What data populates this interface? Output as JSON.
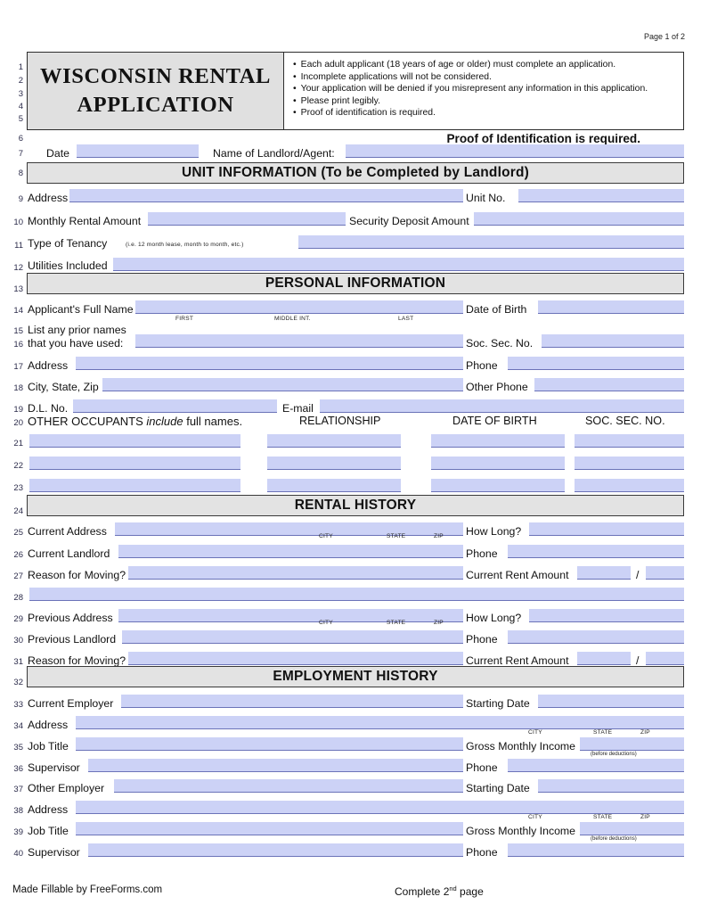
{
  "page": {
    "page_indicator": "Page 1 of 2",
    "title_line1": "WISCONSIN RENTAL",
    "title_line2": "APPLICATION",
    "instructions": [
      "Each adult applicant (18 years of age or older) must complete an application.",
      "Incomplete applications will not be considered.",
      "Your application will be denied if you misrepresent any information in this application.",
      "Please print legibly.",
      "Proof of identification is required."
    ],
    "proof_notice": "Proof of Identification is required."
  },
  "line_numbers": [
    "1",
    "2",
    "3",
    "4",
    "5",
    "6",
    "7",
    "8",
    "9",
    "10",
    "11",
    "12",
    "13",
    "14",
    "15",
    "16",
    "17",
    "18",
    "19",
    "20",
    "21",
    "22",
    "23",
    "24",
    "25",
    "26",
    "27",
    "28",
    "29",
    "30",
    "31",
    "32",
    "33",
    "34",
    "35",
    "36",
    "37",
    "38",
    "39",
    "40"
  ],
  "sections": {
    "unit_information": {
      "title_main": "UNIT INFORMATION",
      "title_paren_open": "(T",
      "title_sub": "o be Completed by Landlord",
      "title_full": "UNIT INFORMATION  (To be Completed by Landlord)"
    },
    "personal_information": {
      "title": "PERSONAL INFORMATION"
    },
    "rental_history": {
      "title": "RENTAL HISTORY"
    },
    "employment_history": {
      "title": "EMPLOYMENT HISTORY"
    }
  },
  "date_row": {
    "date_label": "Date",
    "date_value": "",
    "landlord_label": "Name of Landlord/Agent:",
    "landlord_value": ""
  },
  "unit": {
    "address_label": "Address",
    "address_value": "",
    "unit_no_label": "Unit No.",
    "unit_no_value": "",
    "monthly_rental_label": "Monthly Rental Amount",
    "monthly_rental_value": "",
    "security_deposit_label": "Security Deposit Amount",
    "security_deposit_value": "",
    "tenancy_label": "Type of Tenancy",
    "tenancy_hint": "(i.e. 12 month lease, month to month, etc.)",
    "tenancy_value": "",
    "utilities_label": "Utilities Included",
    "utilities_value": ""
  },
  "personal": {
    "full_name_label": "Applicant's Full Name",
    "full_name_value": "",
    "name_sub_first": "FIRST",
    "name_sub_middle": "MIDDLE INT.",
    "name_sub_last": "LAST",
    "dob_label": "Date of Birth",
    "dob_value": "",
    "prior_names_label_line1": "List any prior names",
    "prior_names_label_line2": "that you have used:",
    "prior_names_value": "",
    "ssn_label": "Soc. Sec. No.",
    "ssn_value": "",
    "address_label": "Address",
    "address_value": "",
    "phone_label": "Phone",
    "phone_value": "",
    "city_state_zip_label": "City, State, Zip",
    "city_state_zip_value": "",
    "other_phone_label": "Other Phone",
    "other_phone_value": "",
    "dl_label": "D.L. No.",
    "dl_value": "",
    "email_label": "E-mail",
    "email_value": ""
  },
  "occupants": {
    "heading_a": "OTHER OCCUPANTS ",
    "heading_italic": "include",
    "heading_b": " full names.",
    "col_relationship": "RELATIONSHIP",
    "col_dob": "DATE OF BIRTH",
    "col_ssn": "SOC. SEC. NO.",
    "rows": [
      {
        "name": "",
        "relationship": "",
        "dob": "",
        "ssn": ""
      },
      {
        "name": "",
        "relationship": "",
        "dob": "",
        "ssn": ""
      },
      {
        "name": "",
        "relationship": "",
        "dob": "",
        "ssn": ""
      }
    ]
  },
  "rental_history": {
    "current_address_label": "Current Address",
    "current_address_value": "",
    "how_long_label": "How Long?",
    "how_long_value": "",
    "sub_city": "CITY",
    "sub_state": "STATE",
    "sub_zip": "ZIP",
    "current_landlord_label": "Current Landlord",
    "current_landlord_value": "",
    "phone_label": "Phone",
    "phone_value": "",
    "reason_moving_label": "Reason for Moving?",
    "reason_moving_value": "",
    "current_rent_label": "Current Rent Amount",
    "current_rent_value": "",
    "current_rent_sep": "/",
    "current_rent_per_value": "",
    "continuation_value": "",
    "previous_address_label": "Previous Address",
    "previous_address_value": "",
    "prev_how_long_label": "How Long?",
    "prev_how_long_value": "",
    "previous_landlord_label": "Previous Landlord",
    "previous_landlord_value": "",
    "prev_phone_label": "Phone",
    "prev_phone_value": "",
    "prev_reason_moving_label": "Reason for Moving?",
    "prev_reason_moving_value": "",
    "prev_current_rent_label": "Current Rent Amount",
    "prev_current_rent_value": "",
    "prev_current_rent_sep": "/",
    "prev_current_rent_per_value": ""
  },
  "employment": {
    "current_employer_label": "Current Employer",
    "current_employer_value": "",
    "starting_date_label": "Starting Date",
    "starting_date_value": "",
    "address_label": "Address",
    "address_value": "",
    "sub_city": "CITY",
    "sub_state": "STATE",
    "sub_zip": "ZIP",
    "job_title_label": "Job Title",
    "job_title_value": "",
    "gross_income_label": "Gross Monthly Income",
    "gross_income_value": "",
    "gross_income_hint": "(before deductions)",
    "supervisor_label": "Supervisor",
    "supervisor_value": "",
    "phone_label": "Phone",
    "phone_value": "",
    "other_employer_label": "Other Employer",
    "other_employer_value": "",
    "other_starting_date_label": "Starting Date",
    "other_starting_date_value": "",
    "other_address_label": "Address",
    "other_address_value": "",
    "other_sub_city": "CITY",
    "other_sub_state": "STATE",
    "other_sub_zip": "ZIP",
    "other_job_title_label": "Job Title",
    "other_job_title_value": "",
    "other_gross_income_label": "Gross Monthly Income",
    "other_gross_income_value": "",
    "other_gross_income_hint": "(before deductions)",
    "other_supervisor_label": "Supervisor",
    "other_supervisor_value": "",
    "other_phone_label": "Phone",
    "other_phone_value": ""
  },
  "footer": {
    "made_fillable": "Made Fillable by FreeForms.com",
    "complete_a": "Complete 2",
    "complete_sup": "nd",
    "complete_b": " page"
  },
  "colors": {
    "field_fill": "#ccd2f6",
    "field_underline": "#6b73b8",
    "section_bar": "#e3e3e3",
    "title_bar": "#e0e0e0",
    "border": "#2d2d2d"
  }
}
